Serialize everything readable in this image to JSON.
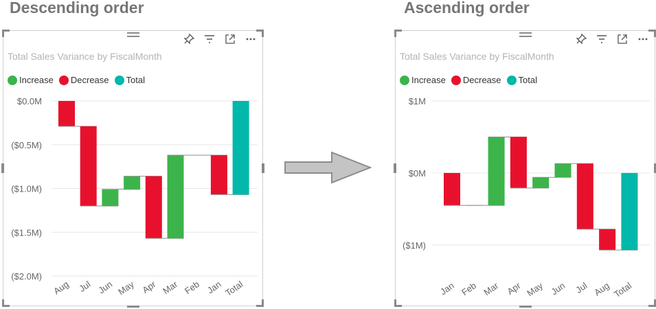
{
  "headings": {
    "left": "Descending order",
    "right": "Ascending order"
  },
  "colors": {
    "increase": "#3cb44b",
    "decrease": "#e8112d",
    "total": "#01b8aa",
    "grid": "#e6e6e6",
    "connector": "#8f8f8f",
    "axis_text": "#666666"
  },
  "toolbar_icons": [
    "pin-icon",
    "filter-icon",
    "focus-mode-icon",
    "more-options-icon"
  ],
  "visuals": [
    {
      "title": "Total Sales Variance by FiscalMonth",
      "legend": [
        {
          "label": "Increase",
          "key": "increase"
        },
        {
          "label": "Decrease",
          "key": "decrease"
        },
        {
          "label": "Total",
          "key": "total"
        }
      ]
    },
    {
      "title": "Total Sales Variance by FiscalMonth",
      "legend": [
        {
          "label": "Increase",
          "key": "increase"
        },
        {
          "label": "Decrease",
          "key": "decrease"
        },
        {
          "label": "Total",
          "key": "total"
        }
      ]
    }
  ],
  "chart_data": [
    {
      "type": "waterfall",
      "title": "Total Sales Variance by FiscalMonth",
      "order": "descending",
      "categories": [
        "Aug",
        "Jul",
        "Jun",
        "May",
        "Apr",
        "Mar",
        "Feb",
        "Jan",
        "Total"
      ],
      "deltas": [
        -0.29,
        -0.91,
        0.19,
        0.15,
        -0.71,
        0.95,
        0.0,
        -0.45,
        null
      ],
      "total": -1.07,
      "unit": "M",
      "ylim": [
        -2.0,
        0.0
      ],
      "yticks": [
        0.0,
        -0.5,
        -1.0,
        -1.5,
        -2.0
      ],
      "ytick_labels": [
        "$0.0M",
        "($0.5M)",
        "($1.0M)",
        "($1.5M)",
        "($2.0M)"
      ],
      "grid": true,
      "legend_position": "top-left"
    },
    {
      "type": "waterfall",
      "title": "Total Sales Variance by FiscalMonth",
      "order": "ascending",
      "categories": [
        "Jan",
        "Feb",
        "Mar",
        "Apr",
        "May",
        "Jun",
        "Jul",
        "Aug",
        "Total"
      ],
      "deltas": [
        -0.45,
        0.0,
        0.95,
        -0.71,
        0.15,
        0.19,
        -0.91,
        -0.29,
        null
      ],
      "total": -1.07,
      "unit": "M",
      "ylim": [
        -1.45,
        1.0
      ],
      "yticks": [
        1.0,
        0.0,
        -1.0
      ],
      "ytick_labels": [
        "$1M",
        "$0M",
        "($1M)"
      ],
      "grid": true,
      "legend_position": "top-left"
    }
  ]
}
